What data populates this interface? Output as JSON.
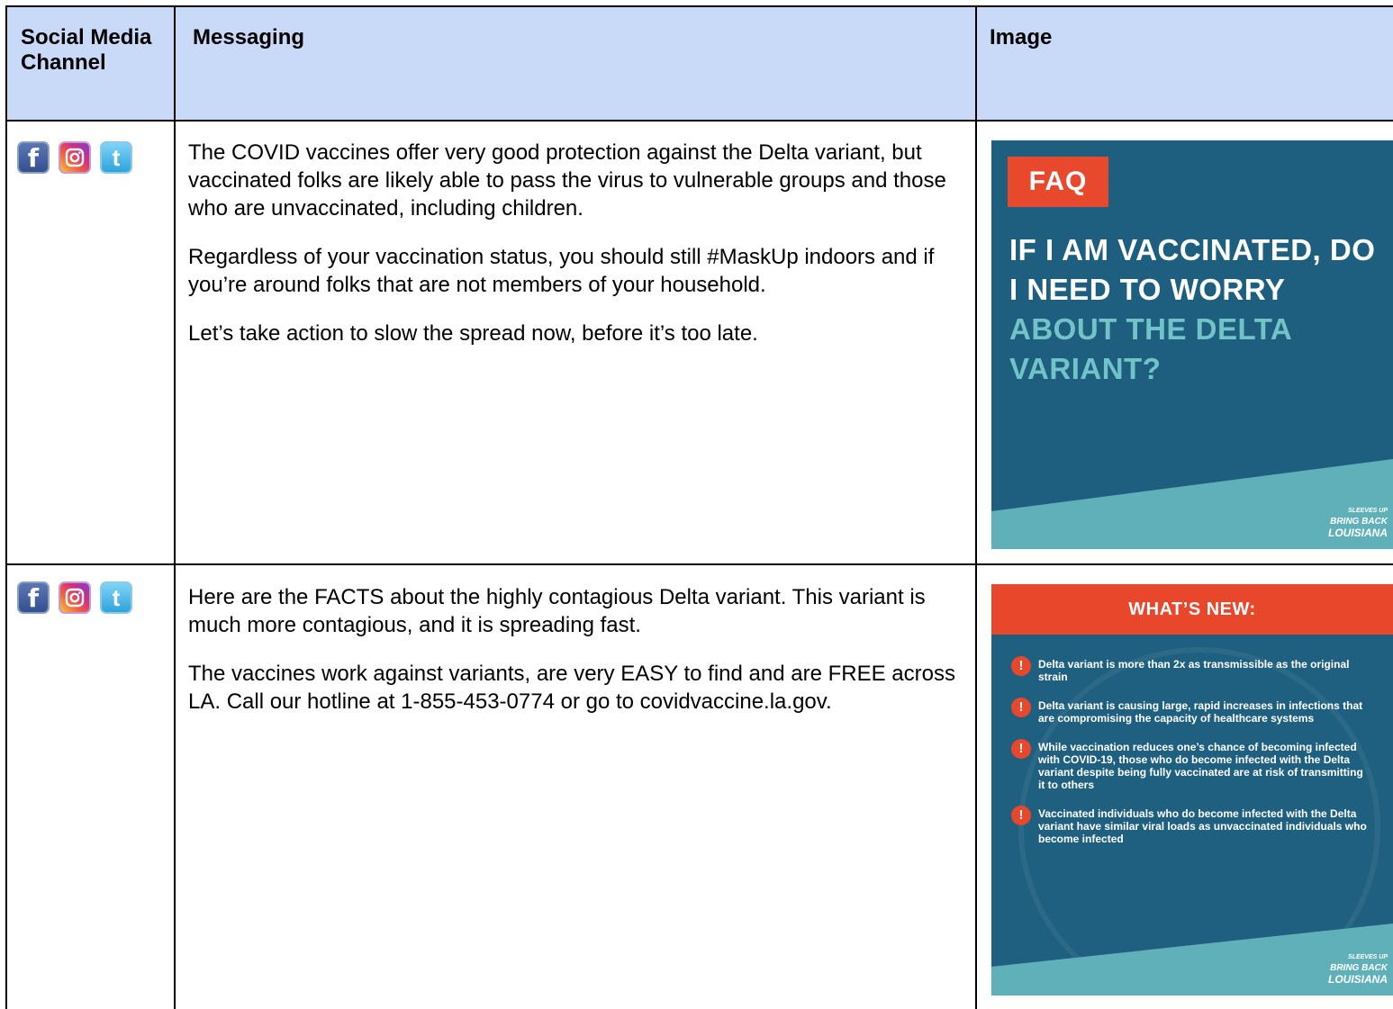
{
  "header": {
    "channel": "Social Media Channel",
    "messaging": "Messaging",
    "image": "Image"
  },
  "rows": [
    {
      "icons": [
        "facebook-icon",
        "instagram-icon",
        "twitter-icon"
      ],
      "paragraphs": [
        "The COVID vaccines offer very good protection against the Delta variant, but vaccinated folks are likely able to pass the virus to vulnerable groups and those who are unvaccinated, including children.",
        "Regardless of your vaccination status, you should still #MaskUp indoors and if you’re around folks that are not members of your household.",
        "Let’s take action to slow the spread now, before it’s too late."
      ],
      "graphic": {
        "tag": "FAQ",
        "question_white": "IF I AM VACCINATED, DO I NEED TO WORRY",
        "question_teal": "ABOUT THE DELTA VARIANT?",
        "brand_line1": "SLEEVES UP",
        "brand_line2": "BRING BACK",
        "brand_line3": "LOUISIANA"
      }
    },
    {
      "icons": [
        "facebook-icon",
        "instagram-icon",
        "twitter-icon"
      ],
      "paragraphs": [
        "Here are the FACTS about the highly contagious Delta variant. This variant is much more contagious, and it is spreading fast.",
        "The vaccines work against variants, are very EASY to find and are FREE across LA. Call our hotline at 1-855-453-0774 or go to covidvaccine.la.gov."
      ],
      "graphic": {
        "banner": "WHAT’S NEW:",
        "items": [
          "Delta variant is more than 2x as transmissible as the original strain",
          "Delta variant is causing large, rapid increases in infections that are compromising the capacity of healthcare systems",
          "While vaccination reduces one’s chance of becoming infected with COVID-19, those who do become infected with the Delta variant despite being fully vaccinated are at risk of transmitting it to others",
          "Vaccinated individuals who do become infected with the Delta variant have similar viral loads as unvaccinated individuals who become infected"
        ],
        "brand_line1": "SLEEVES UP",
        "brand_line2": "BRING BACK",
        "brand_line3": "LOUISIANA"
      }
    }
  ],
  "colors": {
    "header_bg": "#c9daf8",
    "graphic_blue": "#1e5f80",
    "graphic_teal": "#5fb0b8",
    "graphic_orange": "#e8482c"
  }
}
